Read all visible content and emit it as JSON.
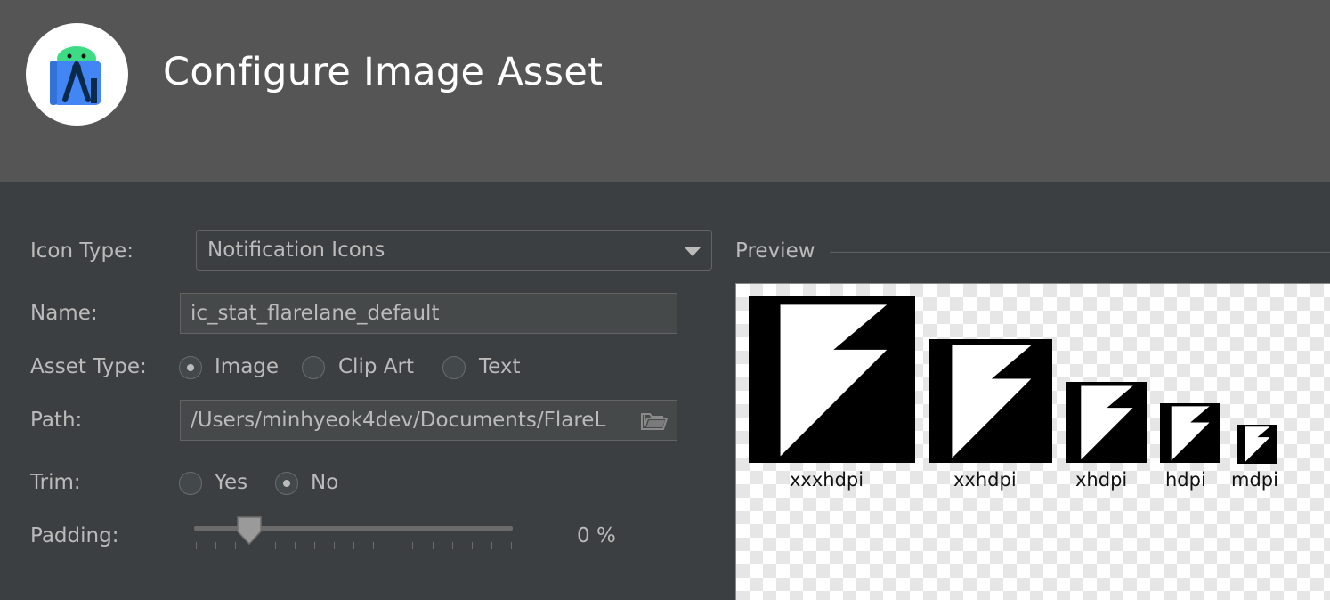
{
  "window": {
    "title": "Configure Image Asset"
  },
  "form": {
    "icon_type": {
      "label": "Icon Type:",
      "value": "Notification Icons"
    },
    "name": {
      "label": "Name:",
      "value": "ic_stat_flarelane_default"
    },
    "asset_type": {
      "label": "Asset Type:",
      "options": [
        "Image",
        "Clip Art",
        "Text"
      ],
      "selected": "Image"
    },
    "path": {
      "label": "Path:",
      "value": "/Users/minhyeok4dev/Documents/FlareL"
    },
    "trim": {
      "label": "Trim:",
      "options": [
        "Yes",
        "No"
      ],
      "selected": "No"
    },
    "padding": {
      "label": "Padding:",
      "value": 0,
      "value_text": "0 %"
    }
  },
  "preview": {
    "label": "Preview",
    "densities": [
      "xxxhdpi",
      "xxhdpi",
      "xhdpi",
      "hdpi",
      "mdpi"
    ]
  },
  "icons": {
    "app_logo": "android-studio-icon",
    "folder": "folder-icon",
    "dropdown": "chevron-down-icon",
    "slider": "slider-thumb-icon",
    "asset": "flarelane-bolt-icon"
  },
  "colors": {
    "header_bg": "#555555",
    "panel_bg": "#3c3f41",
    "text": "#bbbbbb",
    "title": "#ffffff"
  }
}
